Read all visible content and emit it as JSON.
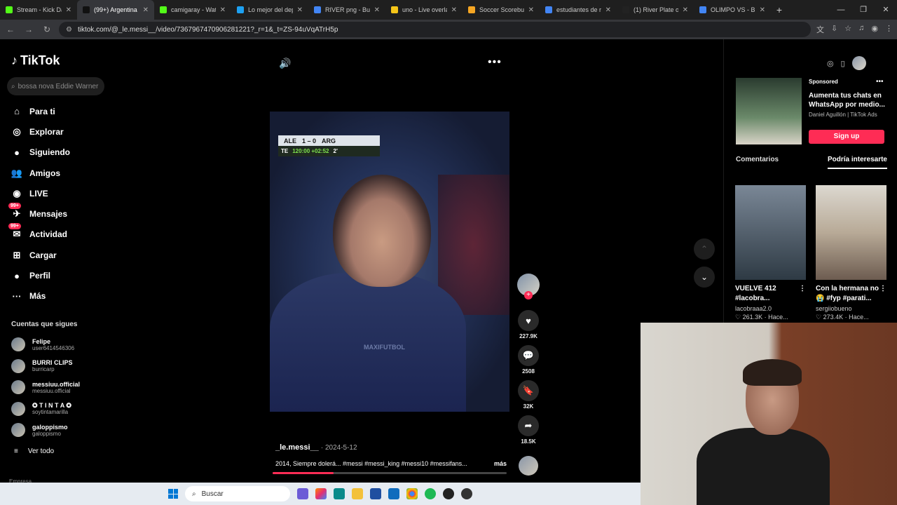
{
  "browser": {
    "tabs": [
      {
        "title": "Stream - Kick Dash",
        "color": "#53fc18",
        "active": false
      },
      {
        "title": "(99+) Argentina",
        "color": "#111111",
        "active": true
      },
      {
        "title": "camigaray - Watch",
        "color": "#53fc18",
        "active": false
      },
      {
        "title": "Lo mejor del deporte",
        "color": "#1da1f2",
        "active": false
      },
      {
        "title": "RIVER png - Buscar",
        "color": "#4285f4",
        "active": false
      },
      {
        "title": "uno - Live overlay",
        "color": "#f5c518",
        "active": false
      },
      {
        "title": "Soccer Scorebug",
        "color": "#f5a623",
        "active": false
      },
      {
        "title": "estudiantes de rio",
        "color": "#4285f4",
        "active": false
      },
      {
        "title": "(1) River Plate on",
        "color": "#222222",
        "active": false
      },
      {
        "title": "OLIMPO VS - Buscar",
        "color": "#4285f4",
        "active": false
      }
    ],
    "url": "tiktok.com/@_le.messi__/video/7367967470906281221?_r=1&_t=ZS-94uVqATrH5p"
  },
  "sidebar": {
    "logo": "TikTok",
    "search_placeholder": "bossa nova Eddie Warner",
    "nav": [
      {
        "label": "Para ti",
        "icon": "home-icon"
      },
      {
        "label": "Explorar",
        "icon": "compass-icon"
      },
      {
        "label": "Siguiendo",
        "icon": "following-avatar-icon"
      },
      {
        "label": "Amigos",
        "icon": "friends-icon"
      },
      {
        "label": "LIVE",
        "icon": "live-icon"
      },
      {
        "label": "Mensajes",
        "icon": "messages-icon",
        "badge": "99+"
      },
      {
        "label": "Actividad",
        "icon": "activity-icon",
        "badge": "99+"
      },
      {
        "label": "Cargar",
        "icon": "upload-icon"
      },
      {
        "label": "Perfil",
        "icon": "profile-icon"
      },
      {
        "label": "Más",
        "icon": "more-icon"
      }
    ],
    "following_title": "Cuentas que sigues",
    "following": [
      {
        "name": "Felipe",
        "handle": "user6414546306"
      },
      {
        "name": "BURRI CLIPS",
        "handle": "burricarp"
      },
      {
        "name": "messiuu.official",
        "handle": "messiuu.official"
      },
      {
        "name": "✪ T I N T A ✪",
        "handle": "soytintamarilla"
      },
      {
        "name": "galoppismo",
        "handle": "galoppismo"
      }
    ],
    "see_all": "Ver todo",
    "company": "Empresa"
  },
  "video": {
    "scoreboard": {
      "home": "ALE",
      "score": "1 – 0",
      "away": "ARG",
      "period": "TE",
      "time": "120:00 +02:52",
      "extra": "2'"
    },
    "watermark": "MAXIFUTBOL",
    "author": "_le.messi__",
    "date": "2024-5-12",
    "caption": "2014, Siempre dolerá... #messi #messi_king #messi10 #messifans...",
    "more": "más",
    "progress": 0.26
  },
  "actions": {
    "likes": "227.9K",
    "comments": "2508",
    "saves": "32K",
    "shares": "18.5K"
  },
  "right_panel": {
    "ad": {
      "sponsored": "Sponsored",
      "text": "Aumenta tus chats en WhatsApp por medio...",
      "by": "Daniel Aguillón | TikTok Ads",
      "cta": "Sign up"
    },
    "tabs": [
      "Comentarios",
      "Podría interesarte"
    ],
    "active_tab": "Podría interesarte",
    "cards": [
      {
        "title": "VUELVE 412 #lacobra...",
        "creator": "lacobraaa2.0",
        "stats": "♡ 261.3K · Hace..."
      },
      {
        "title": "Con la hermana no 😭 #fyp #parati...",
        "creator": "sergiiobueno",
        "stats": "♡ 273.4K · Hace..."
      }
    ]
  },
  "taskbar": {
    "search": "Buscar"
  }
}
